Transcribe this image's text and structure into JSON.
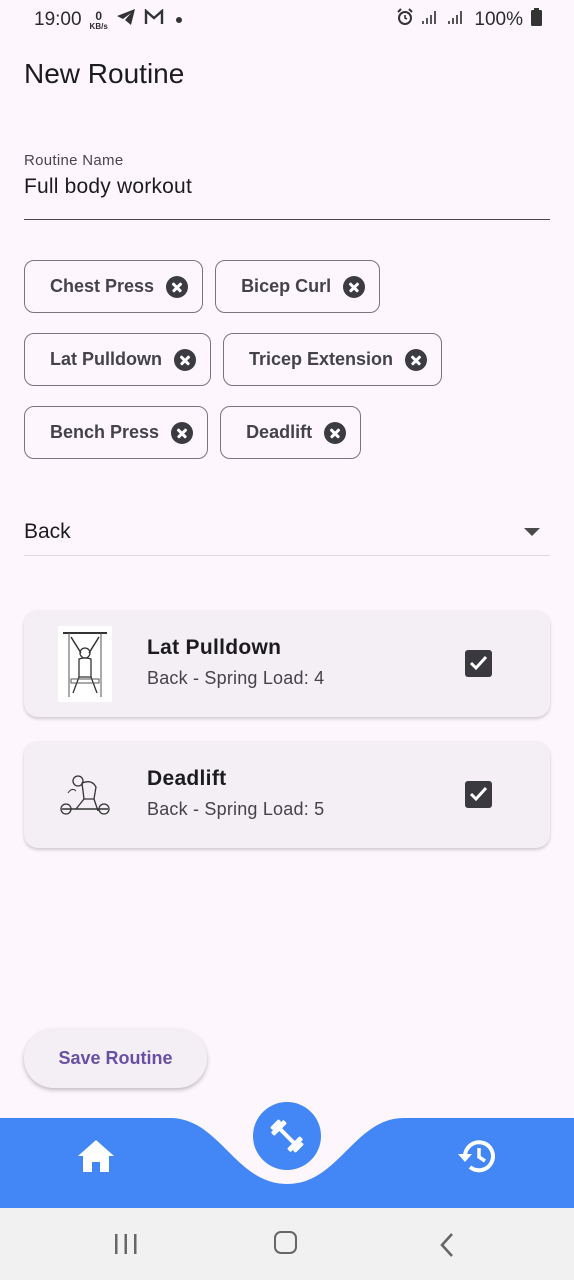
{
  "status_bar": {
    "time": "19:00",
    "data_rate_value": "0",
    "data_rate_unit": "KB/s",
    "battery": "100%",
    "icons": [
      "telegram-icon",
      "gmail-icon",
      "alarm-icon",
      "signal-icon",
      "battery-icon"
    ]
  },
  "page": {
    "title": "New Routine"
  },
  "routine_name": {
    "label": "Routine Name",
    "value": "Full body workout"
  },
  "selected_exercises": [
    {
      "label": "Chest Press"
    },
    {
      "label": "Bicep Curl"
    },
    {
      "label": "Lat Pulldown"
    },
    {
      "label": "Tricep Extension"
    },
    {
      "label": "Bench Press"
    },
    {
      "label": "Deadlift"
    }
  ],
  "muscle_group": {
    "selected": "Back"
  },
  "exercise_list": [
    {
      "name": "Lat Pulldown",
      "detail": "Back - Spring Load: 4",
      "checked": true
    },
    {
      "name": "Deadlift",
      "detail": "Back - Spring Load: 5",
      "checked": true
    }
  ],
  "actions": {
    "save_label": "Save Routine"
  },
  "bottom_nav": {
    "items": [
      "home-icon",
      "dumbbell-icon",
      "history-icon"
    ],
    "color": "#4287f5"
  },
  "colors": {
    "accent": "#6750a4",
    "nav": "#4287f5",
    "background": "#fdf7fd"
  }
}
